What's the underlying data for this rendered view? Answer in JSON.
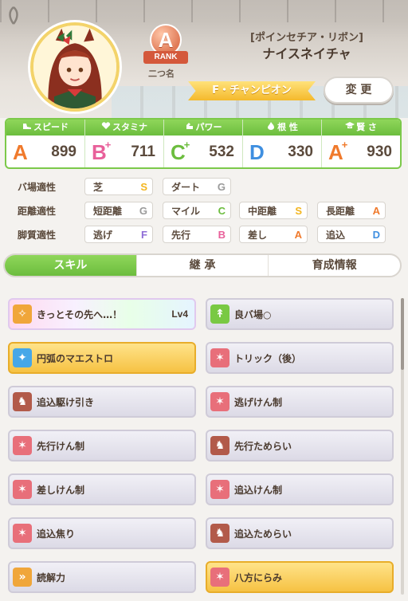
{
  "header": {
    "rank_letter": "A",
    "rank_label": "RANK",
    "nickname_label": "二つ名",
    "epithet": "[ポインセチア・リボン]",
    "character_name": "ナイスネイチャ",
    "title": "F・チャンピオン",
    "change_button": "変 更"
  },
  "stats": [
    {
      "label": "スピード",
      "icon": "shoe-icon",
      "grade": "A",
      "plus": "",
      "value": "899",
      "color": "#f07a2c"
    },
    {
      "label": "スタミナ",
      "icon": "heart-icon",
      "grade": "B",
      "plus": "+",
      "value": "711",
      "color": "#e8609a"
    },
    {
      "label": "パワー",
      "icon": "muscle-icon",
      "grade": "C",
      "plus": "+",
      "value": "532",
      "color": "#6cbd3e"
    },
    {
      "label": "根 性",
      "icon": "flame-icon",
      "grade": "D",
      "plus": "",
      "value": "330",
      "color": "#3f8fe0"
    },
    {
      "label": "賢 さ",
      "icon": "mortarboard-icon",
      "grade": "A",
      "plus": "+",
      "value": "930",
      "color": "#f07a2c"
    }
  ],
  "aptitudes": {
    "track": {
      "label": "バ場適性",
      "items": [
        {
          "name": "芝",
          "grade": "S",
          "color": "#f3b51f"
        },
        {
          "name": "ダート",
          "grade": "G",
          "color": "#9a9a9a"
        }
      ]
    },
    "distance": {
      "label": "距離適性",
      "items": [
        {
          "name": "短距離",
          "grade": "G",
          "color": "#9a9a9a"
        },
        {
          "name": "マイル",
          "grade": "C",
          "color": "#6cbd3e"
        },
        {
          "name": "中距離",
          "grade": "S",
          "color": "#f3b51f"
        },
        {
          "name": "長距離",
          "grade": "A",
          "color": "#f07a2c"
        }
      ]
    },
    "style": {
      "label": "脚質適性",
      "items": [
        {
          "name": "逃げ",
          "grade": "F",
          "color": "#8e6cd6"
        },
        {
          "name": "先行",
          "grade": "B",
          "color": "#e8609a"
        },
        {
          "name": "差し",
          "grade": "A",
          "color": "#f07a2c"
        },
        {
          "name": "追込",
          "grade": "D",
          "color": "#3f8fe0"
        }
      ]
    }
  },
  "tabs": [
    "スキル",
    "継 承",
    "育成情報"
  ],
  "skills": [
    {
      "name": "きっとその先へ…！",
      "level": "Lv4",
      "type": "rainbow",
      "icon": "sparkle-icon",
      "icon_color": "#f0a63a"
    },
    {
      "name": "良バ場○",
      "level": "",
      "type": "normal",
      "icon": "turf-icon",
      "icon_color": "#79c943"
    },
    {
      "name": "円弧のマエストロ",
      "level": "",
      "type": "gold",
      "icon": "curve-icon",
      "icon_color": "#46a7e8"
    },
    {
      "name": "トリック（後）",
      "level": "",
      "type": "normal",
      "icon": "debuff-icon",
      "icon_color": "#e86f7a"
    },
    {
      "name": "追込駆け引き",
      "level": "",
      "type": "normal",
      "icon": "demon-icon",
      "icon_color": "#b25a4a"
    },
    {
      "name": "逃げけん制",
      "level": "",
      "type": "normal",
      "icon": "debuff-icon",
      "icon_color": "#e86f7a"
    },
    {
      "name": "先行けん制",
      "level": "",
      "type": "normal",
      "icon": "debuff-icon",
      "icon_color": "#e86f7a"
    },
    {
      "name": "先行ためらい",
      "level": "",
      "type": "normal",
      "icon": "demon-icon",
      "icon_color": "#b25a4a"
    },
    {
      "name": "差しけん制",
      "level": "",
      "type": "normal",
      "icon": "debuff-icon",
      "icon_color": "#e86f7a"
    },
    {
      "name": "追込けん制",
      "level": "",
      "type": "normal",
      "icon": "debuff-icon",
      "icon_color": "#e86f7a"
    },
    {
      "name": "追込焦り",
      "level": "",
      "type": "normal",
      "icon": "debuff-icon",
      "icon_color": "#e86f7a"
    },
    {
      "name": "追込ためらい",
      "level": "",
      "type": "normal",
      "icon": "demon-icon",
      "icon_color": "#b25a4a"
    },
    {
      "name": "読解力",
      "level": "",
      "type": "normal",
      "icon": "speed-icon",
      "icon_color": "#f0a63a"
    },
    {
      "name": "八方にらみ",
      "level": "",
      "type": "gold",
      "icon": "debuff-icon",
      "icon_color": "#e86f7a"
    }
  ]
}
